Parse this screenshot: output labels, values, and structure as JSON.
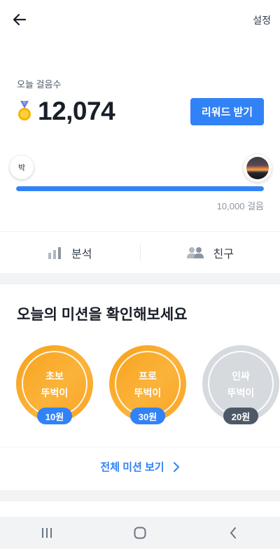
{
  "header": {
    "settings_label": "설정"
  },
  "steps": {
    "label": "오늘 걸음수",
    "value": "12,074",
    "reward_button": "리워드 받기"
  },
  "progress": {
    "start_label": "박",
    "goal_label": "10,000 걸음",
    "fraction": 1.0
  },
  "tabs": [
    {
      "label": "분석",
      "icon": "bar-chart-icon"
    },
    {
      "label": "친구",
      "icon": "people-icon"
    }
  ],
  "missions": {
    "title": "오늘의 미션을 확인해보세요",
    "items": [
      {
        "line1": "초보",
        "line2": "뚜벅이",
        "reward": "10원",
        "state": "active"
      },
      {
        "line1": "프로",
        "line2": "뚜벅이",
        "reward": "30원",
        "state": "active"
      },
      {
        "line1": "인싸",
        "line2": "뚜벅이",
        "reward": "20원",
        "state": "inactive"
      }
    ],
    "all_link": "전체 미션 보기"
  },
  "colors": {
    "accent": "#3182f6",
    "mission_orange": "#f9a425",
    "mission_grey": "#d6dadf",
    "badge_dark": "#4e5968"
  }
}
